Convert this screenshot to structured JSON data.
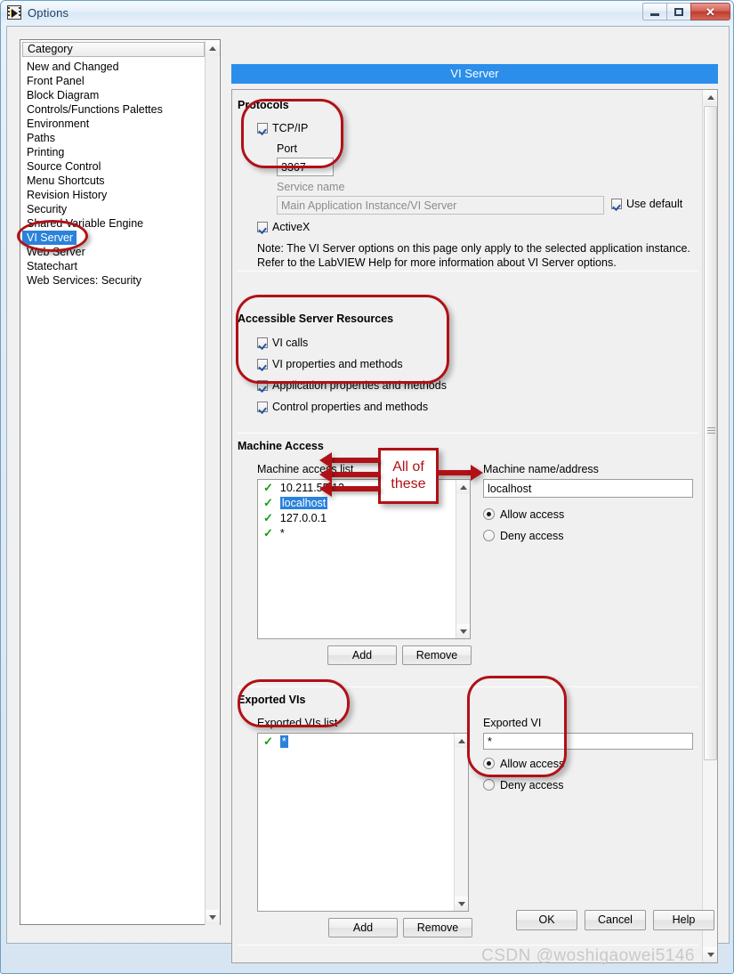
{
  "window": {
    "title": "Options",
    "icon": "labview-icon",
    "minimize_label": "Minimize",
    "maximize_label": "Maximize",
    "close_label": "Close"
  },
  "sidebar": {
    "header": "Category",
    "items": [
      {
        "label": "New and Changed",
        "selected": false
      },
      {
        "label": "Front Panel",
        "selected": false
      },
      {
        "label": "Block Diagram",
        "selected": false
      },
      {
        "label": "Controls/Functions Palettes",
        "selected": false
      },
      {
        "label": "Environment",
        "selected": false
      },
      {
        "label": "Paths",
        "selected": false
      },
      {
        "label": "Printing",
        "selected": false
      },
      {
        "label": "Source Control",
        "selected": false
      },
      {
        "label": "Menu Shortcuts",
        "selected": false
      },
      {
        "label": "Revision History",
        "selected": false
      },
      {
        "label": "Security",
        "selected": false
      },
      {
        "label": "Shared Variable Engine",
        "selected": false
      },
      {
        "label": "VI Server",
        "selected": true
      },
      {
        "label": "Web Server",
        "selected": false
      },
      {
        "label": "Statechart",
        "selected": false
      },
      {
        "label": "Web Services: Security",
        "selected": false
      }
    ]
  },
  "page": {
    "title": "VI Server"
  },
  "protocols": {
    "group_title": "Protocols",
    "tcpip": {
      "label": "TCP/IP",
      "checked": true
    },
    "port": {
      "label": "Port",
      "value": "3367"
    },
    "service_name": {
      "label": "Service name",
      "value": "Main Application Instance/VI Server",
      "disabled": true
    },
    "use_default": {
      "label": "Use default",
      "checked": true
    },
    "activex": {
      "label": "ActiveX",
      "checked": true
    },
    "note": "Note: The VI Server options on this page only apply to the selected application instance. Refer to the LabVIEW Help for more information about VI Server options."
  },
  "resources": {
    "group_title": "Accessible Server Resources",
    "items": [
      {
        "label": "VI calls",
        "checked": true
      },
      {
        "label": "VI properties and methods",
        "checked": true
      },
      {
        "label": "Application properties and methods",
        "checked": true
      },
      {
        "label": "Control properties and methods",
        "checked": true
      }
    ]
  },
  "machine_access": {
    "group_title": "Machine Access",
    "list_label": "Machine access list",
    "list_items": [
      {
        "mark": "✓",
        "text": "10.211.55.12",
        "selected": false
      },
      {
        "mark": "✓",
        "text": "localhost",
        "selected": true
      },
      {
        "mark": "✓",
        "text": "127.0.0.1",
        "selected": false
      },
      {
        "mark": "✓",
        "text": "*",
        "selected": false
      }
    ],
    "field_label": "Machine name/address",
    "field_value": "localhost",
    "allow_label": "Allow access",
    "deny_label": "Deny access",
    "allow_selected": true,
    "add_label": "Add",
    "remove_label": "Remove"
  },
  "exported_vis": {
    "group_title": "Exported VIs",
    "list_label": "Exported VIs list",
    "list_items": [
      {
        "mark": "✓",
        "text": "*",
        "selected": true
      }
    ],
    "field_label": "Exported VI",
    "field_value": "*",
    "allow_label": "Allow access",
    "deny_label": "Deny access",
    "allow_selected": true,
    "add_label": "Add",
    "remove_label": "Remove"
  },
  "annotations": {
    "callout_line1": "All of",
    "callout_line2": "these",
    "color": "#b01116"
  },
  "footer": {
    "ok_label": "OK",
    "cancel_label": "Cancel",
    "help_label": "Help"
  },
  "watermark": "CSDN @woshigaowei5146"
}
